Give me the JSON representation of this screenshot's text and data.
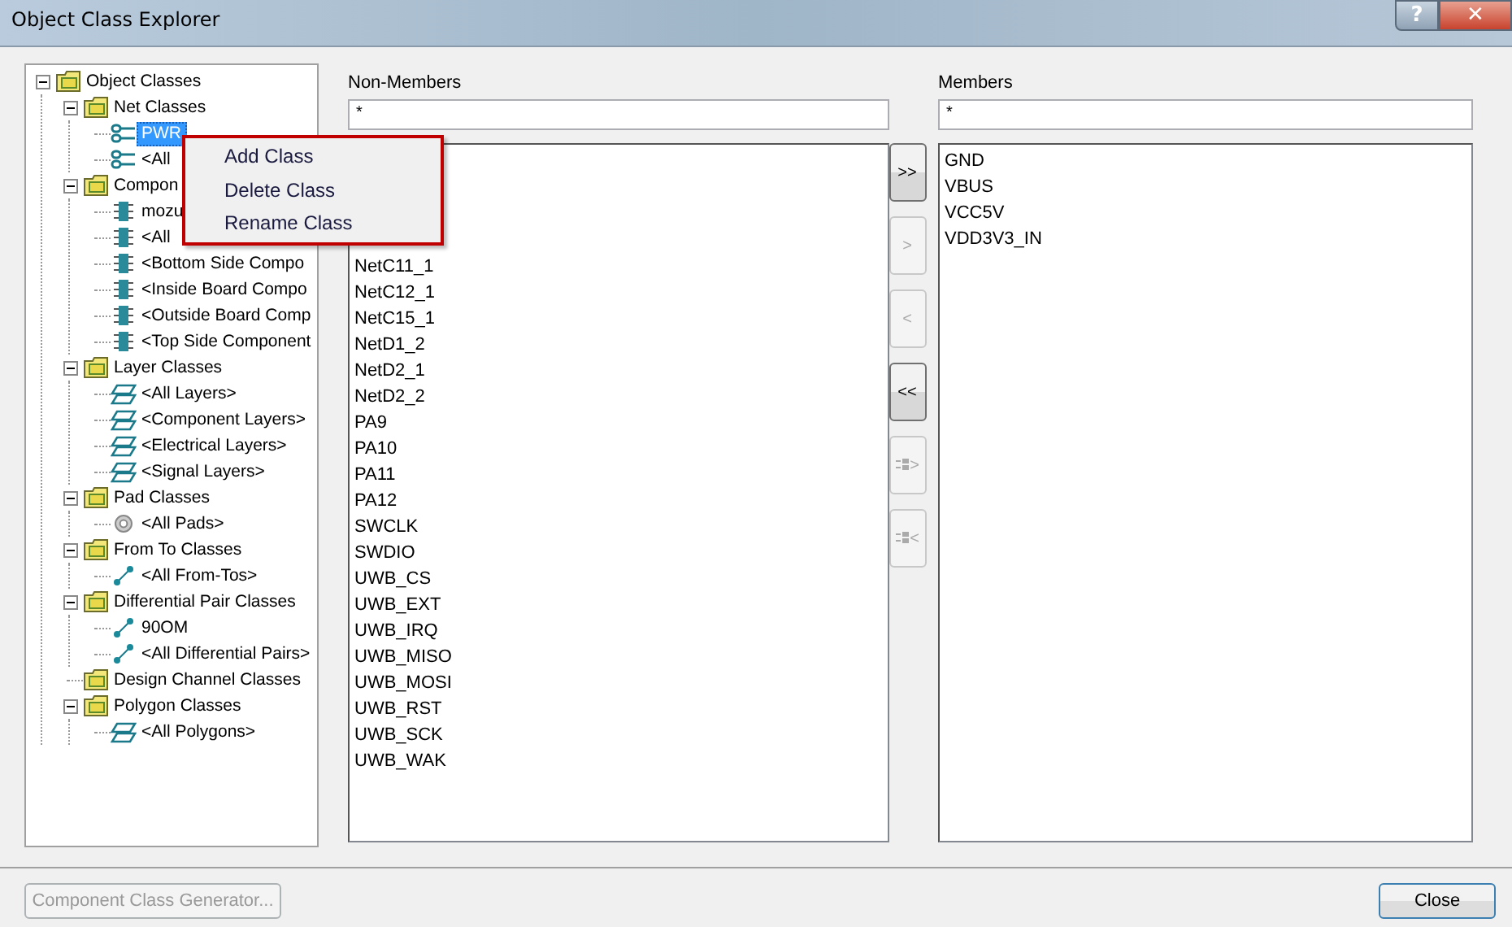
{
  "window": {
    "title": "Object Class Explorer",
    "help": "?",
    "close": "✕"
  },
  "tree": [
    {
      "label": "Object Classes",
      "kind": "folder",
      "expanded": true,
      "selected": false,
      "children": [
        {
          "label": "Net Classes",
          "kind": "folder",
          "expanded": true,
          "selected": false,
          "children": [
            {
              "label": "PWR",
              "kind": "net",
              "selected": true
            },
            {
              "label": "<All",
              "kind": "net",
              "selected": false
            }
          ]
        },
        {
          "label": "Compon",
          "kind": "folder",
          "expanded": true,
          "selected": false,
          "children": [
            {
              "label": "mozu",
              "kind": "component",
              "selected": false
            },
            {
              "label": "<All",
              "kind": "component",
              "selected": false
            },
            {
              "label": "<Bottom Side Compo",
              "kind": "component",
              "selected": false
            },
            {
              "label": "<Inside Board Compo",
              "kind": "component",
              "selected": false
            },
            {
              "label": "<Outside Board Comp",
              "kind": "component",
              "selected": false
            },
            {
              "label": "<Top Side Component",
              "kind": "component",
              "selected": false
            }
          ]
        },
        {
          "label": "Layer Classes",
          "kind": "folder",
          "expanded": true,
          "selected": false,
          "children": [
            {
              "label": "<All Layers>",
              "kind": "layer",
              "selected": false
            },
            {
              "label": "<Component Layers>",
              "kind": "layer",
              "selected": false
            },
            {
              "label": "<Electrical Layers>",
              "kind": "layer",
              "selected": false
            },
            {
              "label": "<Signal Layers>",
              "kind": "layer",
              "selected": false
            }
          ]
        },
        {
          "label": "Pad Classes",
          "kind": "folder",
          "expanded": true,
          "selected": false,
          "children": [
            {
              "label": "<All Pads>",
              "kind": "pad",
              "selected": false
            }
          ]
        },
        {
          "label": "From To Classes",
          "kind": "folder",
          "expanded": true,
          "selected": false,
          "children": [
            {
              "label": "<All From-Tos>",
              "kind": "link",
              "selected": false
            }
          ]
        },
        {
          "label": "Differential Pair Classes",
          "kind": "folder",
          "expanded": true,
          "selected": false,
          "children": [
            {
              "label": "90OM",
              "kind": "link",
              "selected": false
            },
            {
              "label": "<All Differential Pairs>",
              "kind": "link",
              "selected": false
            }
          ]
        },
        {
          "label": "Design Channel Classes",
          "kind": "folder",
          "selected": false
        },
        {
          "label": "Polygon Classes",
          "kind": "folder",
          "expanded": true,
          "selected": false,
          "children": [
            {
              "label": "<All Polygons>",
              "kind": "layer",
              "selected": false
            }
          ]
        }
      ]
    }
  ],
  "context_menu": [
    "Add Class",
    "Delete Class",
    "Rename Class"
  ],
  "non_members": {
    "label": "Non-Members",
    "filter": "*",
    "items": [
      "NetC11_1",
      "NetC12_1",
      "NetC15_1",
      "NetD1_2",
      "NetD2_1",
      "NetD2_2",
      "PA9",
      "PA10",
      "PA11",
      "PA12",
      "SWCLK",
      "SWDIO",
      "UWB_CS",
      "UWB_EXT",
      "UWB_IRQ",
      "UWB_MISO",
      "UWB_MOSI",
      "UWB_RST",
      "UWB_SCK",
      "UWB_WAK"
    ]
  },
  "transfer_buttons": [
    {
      "label": ">>",
      "kind": "text",
      "disabled": false
    },
    {
      "label": ">",
      "kind": "text",
      "disabled": true
    },
    {
      "label": "<",
      "kind": "text",
      "disabled": true
    },
    {
      "label": "<<",
      "kind": "text",
      "disabled": false
    },
    {
      "label": ">",
      "kind": "selected",
      "disabled": true
    },
    {
      "label": "<",
      "kind": "selected",
      "disabled": true
    }
  ],
  "members": {
    "label": "Members",
    "filter": "*",
    "items": [
      "GND",
      "VBUS",
      "VCC5V",
      "VDD3V3_IN"
    ]
  },
  "footer": {
    "generator": {
      "label": "Component Class Generator...",
      "disabled": true
    },
    "close": {
      "label": "Close",
      "disabled": false
    }
  }
}
